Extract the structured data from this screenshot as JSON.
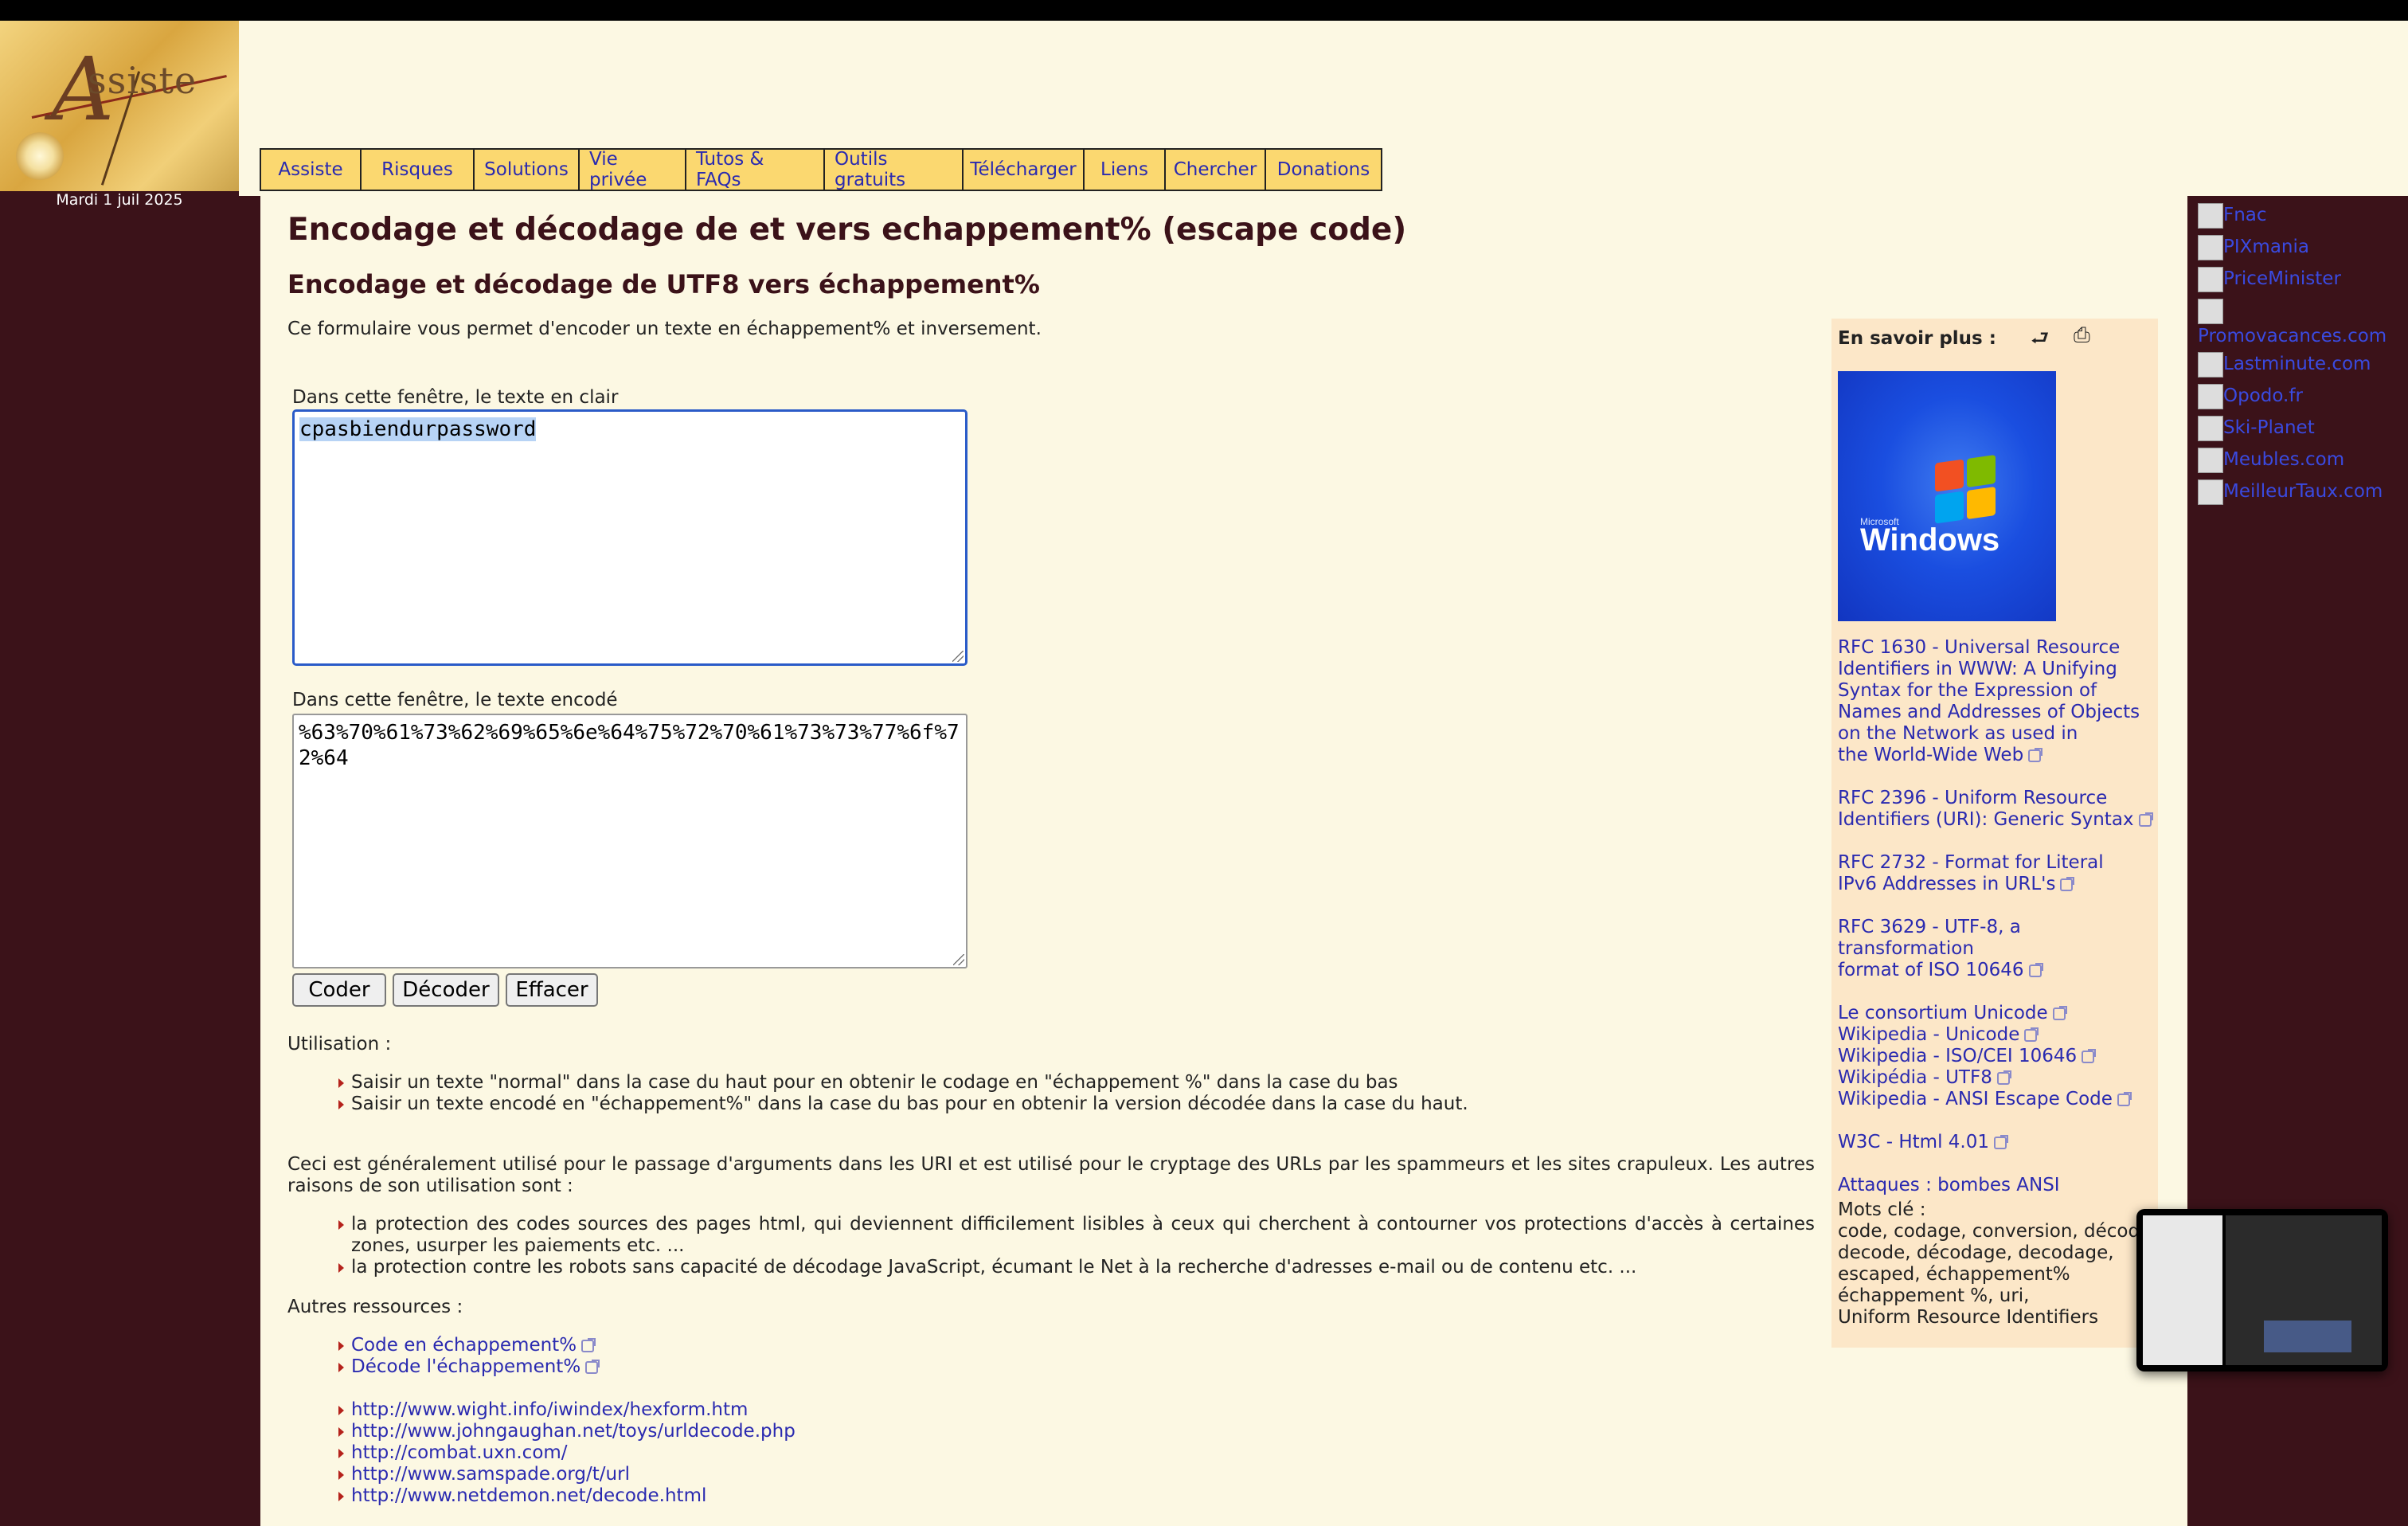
{
  "header": {
    "logo_text": "ssiste",
    "logo_initial": "A",
    "date": "Mardi 1 juil 2025"
  },
  "nav": {
    "items": [
      "Assiste",
      "Risques",
      "Solutions",
      "Vie privée",
      "Tutos & FAQs",
      "Outils gratuits",
      "Télécharger",
      "Liens",
      "Chercher",
      "Donations"
    ]
  },
  "main": {
    "title": "Encodage et décodage de et vers echappement% (escape code)",
    "subtitle": "Encodage et décodage de UTF8 vers échappement%",
    "intro": "Ce formulaire vous permet d'encoder un texte en échappement% et inversement.",
    "plain_label": "Dans cette fenêtre, le texte en clair",
    "plain_value": "cpasbiendurpassword",
    "encoded_label": "Dans cette fenêtre, le texte encodé",
    "encoded_value": "%63%70%61%73%62%69%65%6e%64%75%72%70%61%73%73%77%6f%72%64",
    "buttons": {
      "code": "Coder",
      "decode": "Décoder",
      "clear": "Effacer"
    },
    "usage_title": "Utilisation :",
    "usage_items": [
      "Saisir un texte \"normal\" dans la case du haut pour en obtenir le codage en \"échappement %\" dans la case du bas",
      "Saisir un texte encodé en \"échappement%\" dans la case du bas pour en obtenir la version décodée dans la case du haut."
    ],
    "para": "Ceci est généralement utilisé pour le passage d'arguments dans les URI et est utilisé pour le cryptage des URLs par les spammeurs et les sites crapuleux. Les autres raisons de son utilisation sont :",
    "reasons": [
      "la protection des codes sources des pages html, qui deviennent difficilement lisibles à ceux qui cherchent à contourner vos protections d'accès à certaines zones, usurper les paiements etc. ...",
      "la protection contre les robots sans capacité de décodage JavaScript, écumant le Net à la recherche d'adresses e-mail ou de contenu etc. ..."
    ],
    "resources_title": "Autres ressources :",
    "resources_a": [
      "Code en échappement%",
      "Décode l'échappement%"
    ],
    "resources_b": [
      "http://www.wight.info/iwindex/hexform.htm",
      "http://www.johngaughan.net/toys/urldecode.php",
      "http://combat.uxn.com/",
      "http://www.samspade.org/t/url",
      "http://www.netdemon.net/decode.html"
    ]
  },
  "aside": {
    "title": "En savoir plus :",
    "windows_word": "Windows",
    "windows_ms": "Microsoft",
    "links": [
      {
        "lines": [
          "RFC 1630 - Universal Resource",
          "Identifiers in WWW: A Unifying",
          "Syntax for the Expression of",
          "Names and Addresses of Objects",
          "on the Network as used in",
          "the World-Wide Web"
        ]
      },
      {
        "lines": [
          "RFC 2396 - Uniform Resource",
          "Identifiers (URI): Generic Syntax"
        ]
      },
      {
        "lines": [
          "RFC 2732 - Format for Literal",
          "IPv6 Addresses in URL's"
        ]
      },
      {
        "lines": [
          "RFC 3629 - UTF-8, a transformation",
          "format of ISO 10646"
        ]
      }
    ],
    "group_links": [
      "Le consortium Unicode",
      "Wikipedia - Unicode",
      "Wikipedia - ISO/CEI 10646",
      "Wikipédia - UTF8",
      "Wikipedia - ANSI Escape Code"
    ],
    "w3c": "W3C - Html 4.01",
    "attacks": "Attaques : bombes ANSI",
    "keywords_title": "Mots clé :",
    "keywords": [
      "code, codage, conversion, décode,",
      "decode, décodage, decodage,",
      "escaped, échappement%",
      "échappement %, uri,",
      "Uniform Resource Identifiers"
    ]
  },
  "right_column": [
    "Fnac",
    "PIXmania",
    "PriceMinister",
    "Promovacances.com",
    "Lastminute.com",
    "Opodo.fr",
    "Ski-Planet",
    "Meubles.com",
    "MeilleurTaux.com"
  ],
  "colors": {
    "bg_dark": "#3b1219",
    "content_bg": "#fcf8e3",
    "nav_bg": "#fbd870",
    "link": "#2a2ab0",
    "aside_bg": "#fce7c8"
  }
}
